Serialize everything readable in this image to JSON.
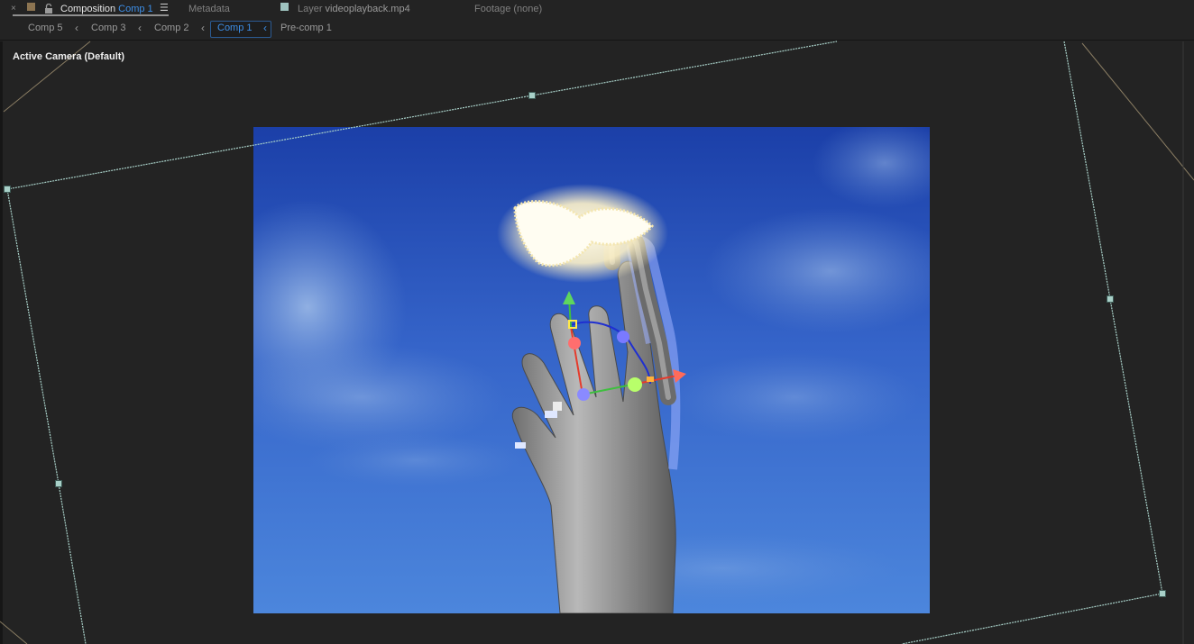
{
  "tabs": [
    {
      "prefix": "Composition",
      "name": "Comp 1",
      "active": true,
      "swatch": "#8c7451"
    },
    {
      "prefix": "Metadata",
      "name": "",
      "active": false
    },
    {
      "prefix": "Layer",
      "name": "videoplayback.mp4",
      "active": false,
      "swatch": "#9fc4c0"
    },
    {
      "prefix": "Footage",
      "name": "(none)",
      "active": false
    }
  ],
  "breadcrumbs": [
    "Comp 5",
    "Comp 3",
    "Comp 2",
    "Comp 1",
    "Pre-comp 1"
  ],
  "viewer": {
    "camera_label": "Active Camera (Default)"
  },
  "colors": {
    "accent": "#3d8ee6",
    "panel_bg": "#232323",
    "camera_frame": "#a8d0c8",
    "axis_x": "#e53b2c",
    "axis_y": "#3fbf3f",
    "axis_z": "#2a35c8"
  },
  "icons": [
    "close-icon",
    "lock-icon",
    "panel-menu-icon",
    "chevron-left-icon"
  ]
}
